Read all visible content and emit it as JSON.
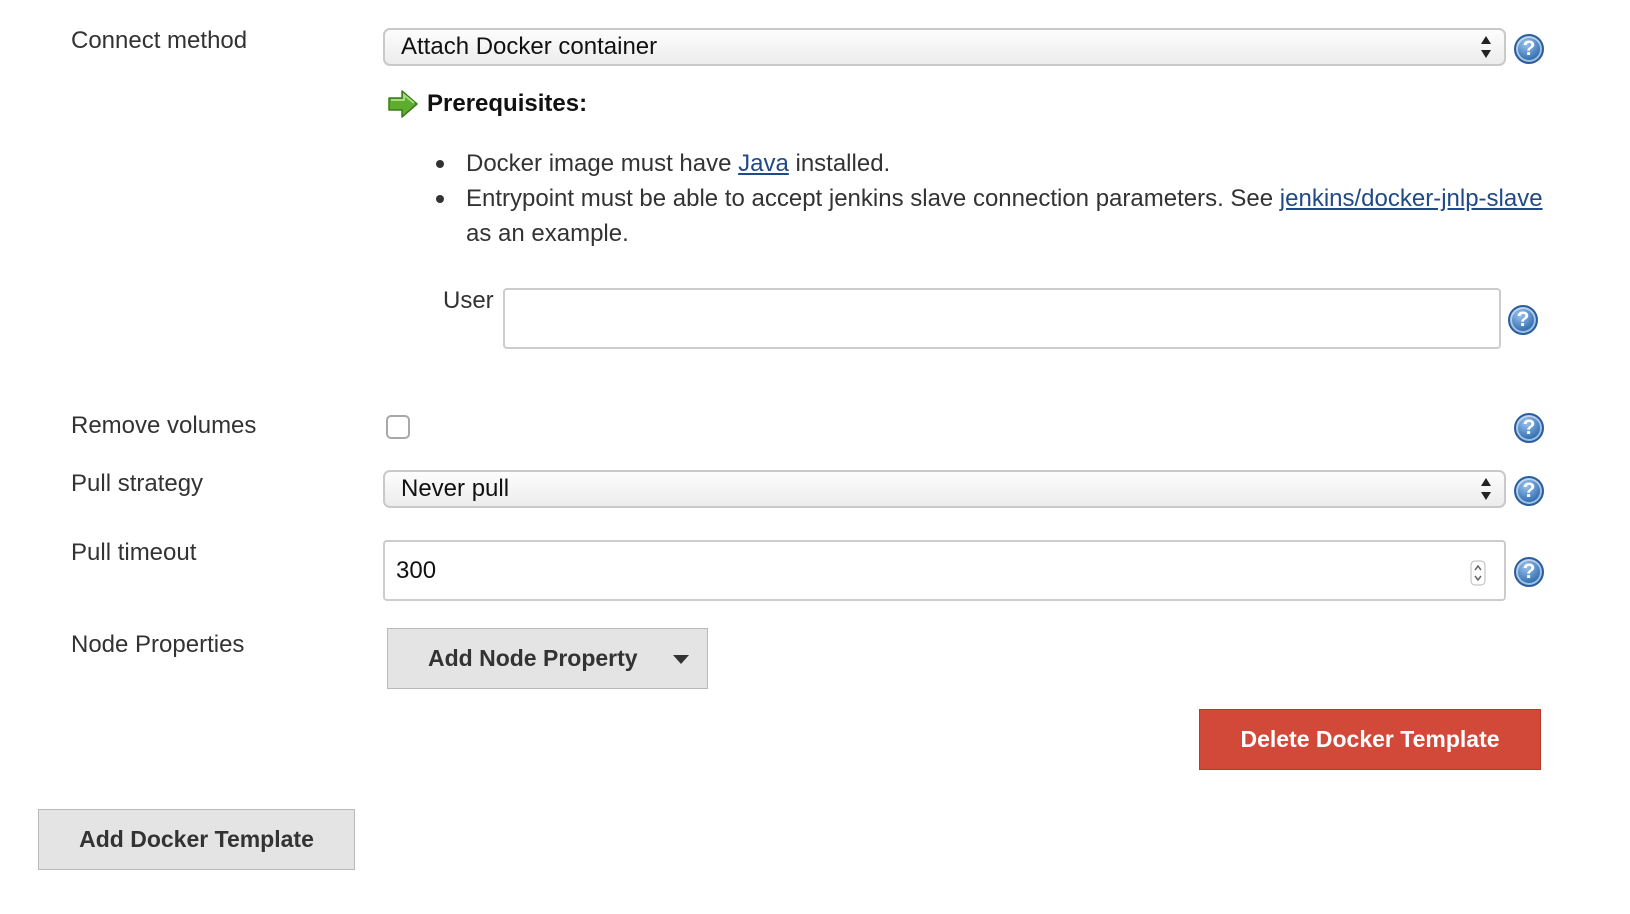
{
  "connect_method": {
    "label": "Connect method",
    "selected": "Attach Docker container",
    "prerequisites_title": "Prerequisites:",
    "bullet1": {
      "pre": "Docker image must have ",
      "link": "Java",
      "post": " installed."
    },
    "bullet2": {
      "pre": "Entrypoint must be able to accept jenkins slave connection parameters. See ",
      "link": "jenkins/docker-jnlp-slave",
      "post": " as an example."
    },
    "user_label": "User",
    "user_value": ""
  },
  "remove_volumes": {
    "label": "Remove volumes",
    "checked": false
  },
  "pull_strategy": {
    "label": "Pull strategy",
    "selected": "Never pull"
  },
  "pull_timeout": {
    "label": "Pull timeout",
    "value": "300"
  },
  "node_properties": {
    "label": "Node Properties",
    "button_label": "Add Node Property"
  },
  "delete_button": "Delete Docker Template",
  "add_button": "Add Docker Template",
  "help_glyph": "?",
  "icons": {
    "help": "help-icon",
    "prerequisites": "green-arrow-icon"
  },
  "colors": {
    "link": "#204a87",
    "danger": "#d24939",
    "help": "#2f6db3"
  }
}
